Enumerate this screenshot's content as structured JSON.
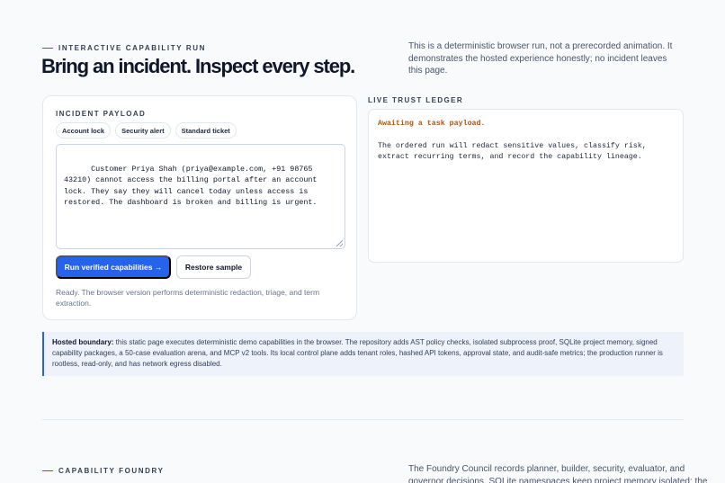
{
  "hero": {
    "eyebrow": "Interactive capability run",
    "title": "Bring an incident. Inspect every step.",
    "description": "This is a deterministic browser run, not a prerecorded animation. It demonstrates the hosted experience honestly; no incident leaves this page."
  },
  "payload": {
    "label": "Incident payload",
    "presets": [
      "Account lock",
      "Security alert",
      "Standard ticket"
    ],
    "text": "Customer Priya Shah (priya@example.com, +91 98765 43210) cannot access the billing portal after an account lock. They say they will cancel today unless access is restored. The dashboard is broken and billing is urgent.",
    "run_label": "Run verified capabilities →",
    "restore_label": "Restore sample",
    "status": "Ready. The browser version performs deterministic redaction, triage, and term extraction."
  },
  "ledger": {
    "label": "Live trust ledger",
    "status": "Awaiting a task payload.",
    "body": "The ordered run will redact sensitive values, classify risk, extract recurring terms, and record the capability lineage."
  },
  "boundary": {
    "label": "Hosted boundary:",
    "text": " this static page executes deterministic demo capabilities in the browser. The repository adds AST policy checks, isolated subprocess proof, SQLite project memory, signed capability packages, a 50-case evaluation arena, and MCP v2 tools. Its local control plane adds tenant roles, hashed API tokens, approval state, and audit-safe metrics; the production runner is rootless, read-only, and has network egress disabled."
  },
  "foundry": {
    "eyebrow": "Capability foundry",
    "description_line1": "The Foundry Council records planner, builder, security, evaluator, and",
    "description_line2": "governor decisions. SQLite namespaces keep project memory isolated; the"
  },
  "colors": {
    "accent": "#2563eb",
    "status_amber": "#b45309",
    "background": "#f8fafc"
  }
}
